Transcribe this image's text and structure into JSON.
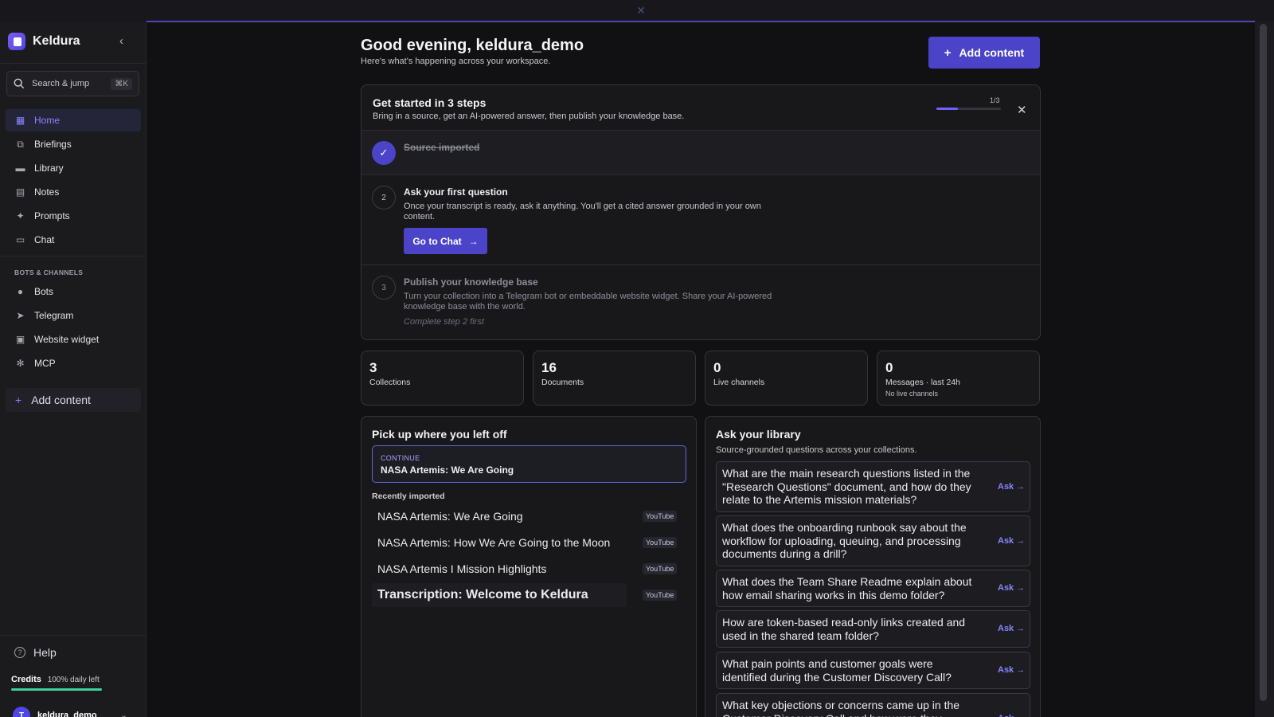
{
  "banner": {
    "close_icon": "close-icon"
  },
  "sidebar": {
    "brand": "Keldura",
    "search": {
      "label": "Search & jump",
      "shortcut": "⌘K"
    },
    "nav": [
      {
        "label": "Home",
        "icon": "home-icon",
        "active": true
      },
      {
        "label": "Briefings",
        "icon": "briefings-icon"
      },
      {
        "label": "Library",
        "icon": "folder-icon"
      },
      {
        "label": "Notes",
        "icon": "notes-icon"
      },
      {
        "label": "Prompts",
        "icon": "sparkles-icon"
      },
      {
        "label": "Chat",
        "icon": "chat-icon"
      }
    ],
    "section_label": "BOTS & CHANNELS",
    "channels": [
      {
        "label": "Bots",
        "icon": "bot-icon"
      },
      {
        "label": "Telegram",
        "icon": "send-icon"
      },
      {
        "label": "Website widget",
        "icon": "widget-icon"
      },
      {
        "label": "MCP",
        "icon": "mcp-icon"
      }
    ],
    "add_content": "Add content",
    "help": "Help",
    "credits": {
      "label": "Credits",
      "value": "100% daily left",
      "fraction": 1.0
    },
    "user": {
      "name": "keldura_demo",
      "initial": "T"
    }
  },
  "header": {
    "greeting": "Good evening, keldura_demo",
    "subtitle": "Here's what's happening across your workspace.",
    "add_button": "Add content"
  },
  "getting_started": {
    "title": "Get started in 3 steps",
    "subtitle": "Bring in a source, get an AI-powered answer, then publish your knowledge base.",
    "progress_text": "1/3",
    "progress": 0.333,
    "steps": [
      {
        "number": "✓",
        "title": "Source imported"
      },
      {
        "number": "2",
        "title": "Ask your first question",
        "description": "Once your transcript is ready, ask it anything. You'll get a cited answer grounded in your own content.",
        "button": "Go to Chat"
      },
      {
        "number": "3",
        "title": "Publish your knowledge base",
        "description": "Turn your collection into a Telegram bot or embeddable website widget. Share your AI-powered knowledge base with the world.",
        "hint": "Complete step 2 first"
      }
    ]
  },
  "stats": [
    {
      "value": "3",
      "label": "Collections"
    },
    {
      "value": "16",
      "label": "Documents"
    },
    {
      "value": "0",
      "label": "Live channels"
    },
    {
      "value": "0",
      "label": "Messages · last 24h",
      "sub": "No live channels"
    }
  ],
  "pick_up": {
    "title": "Pick up where you left off",
    "continue_label": "CONTINUE",
    "continue_title": "NASA Artemis: We Are Going",
    "recent_label": "Recently imported",
    "recent": [
      {
        "title": "NASA Artemis: We Are Going",
        "source": "YouTube"
      },
      {
        "title": "NASA Artemis: How We Are Going to the Moon",
        "source": "YouTube"
      },
      {
        "title": "NASA Artemis I Mission Highlights",
        "source": "YouTube"
      },
      {
        "title": "Transcription: Welcome to Keldura",
        "source": "YouTube"
      }
    ]
  },
  "ask_library": {
    "title": "Ask your library",
    "subtitle": "Source-grounded questions across your collections.",
    "ask_label": "Ask →",
    "questions": [
      "What are the main research questions listed in the \"Research Questions\" document, and how do they relate to the Artemis mission materials?",
      "What does the onboarding runbook say about the workflow for uploading, queuing, and processing documents during a drill?",
      "What does the Team Share Readme explain about how email sharing works in this demo folder?",
      "How are token-based read-only links created and used in the shared team folder?",
      "What pain points and customer goals were identified during the Customer Discovery Call?",
      "What key objections or concerns came up in the Customer Discovery Call and how were they"
    ]
  }
}
